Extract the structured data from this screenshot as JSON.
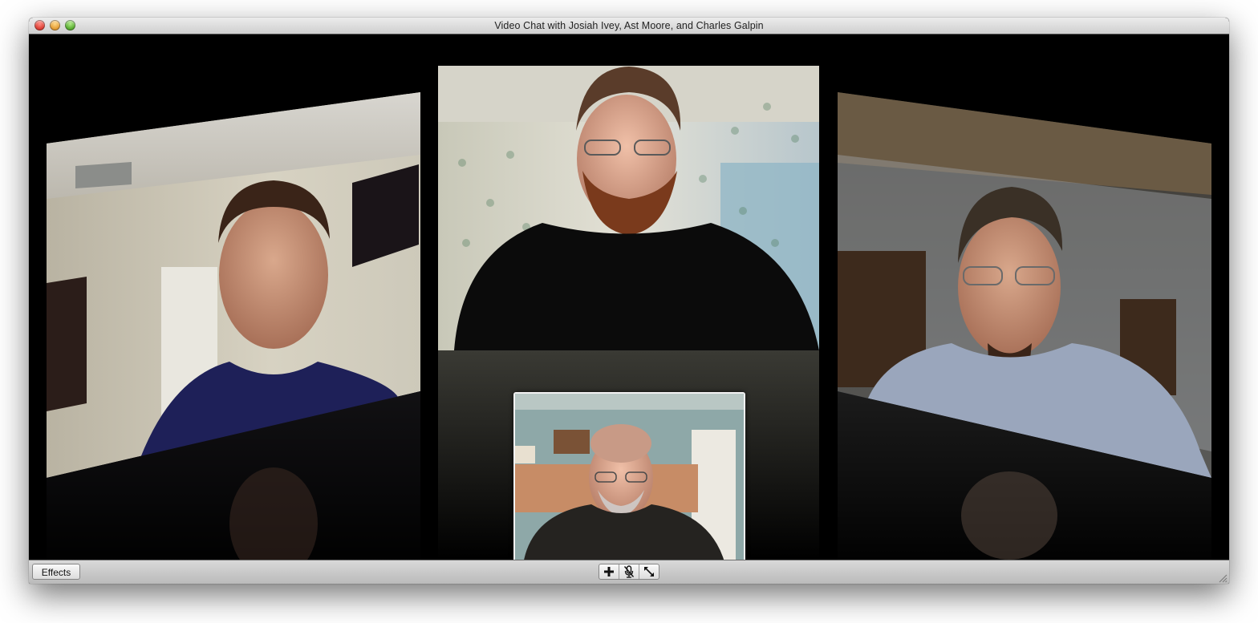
{
  "window": {
    "title": "Video Chat with Josiah Ivey, Ast Moore, and Charles Galpin"
  },
  "participants": [
    {
      "position": "left"
    },
    {
      "position": "center"
    },
    {
      "position": "right"
    }
  ],
  "toolbar": {
    "effects_label": "Effects",
    "controls": [
      {
        "icon": "add-icon"
      },
      {
        "icon": "mute-microphone-icon"
      },
      {
        "icon": "fullscreen-icon"
      }
    ]
  },
  "colors": {
    "titlebar_top": "#ececec",
    "titlebar_bottom": "#cfcfcf",
    "stage_background": "#000000",
    "close": "#e0443a",
    "minimize": "#e7a23a",
    "zoom": "#5fb236"
  }
}
